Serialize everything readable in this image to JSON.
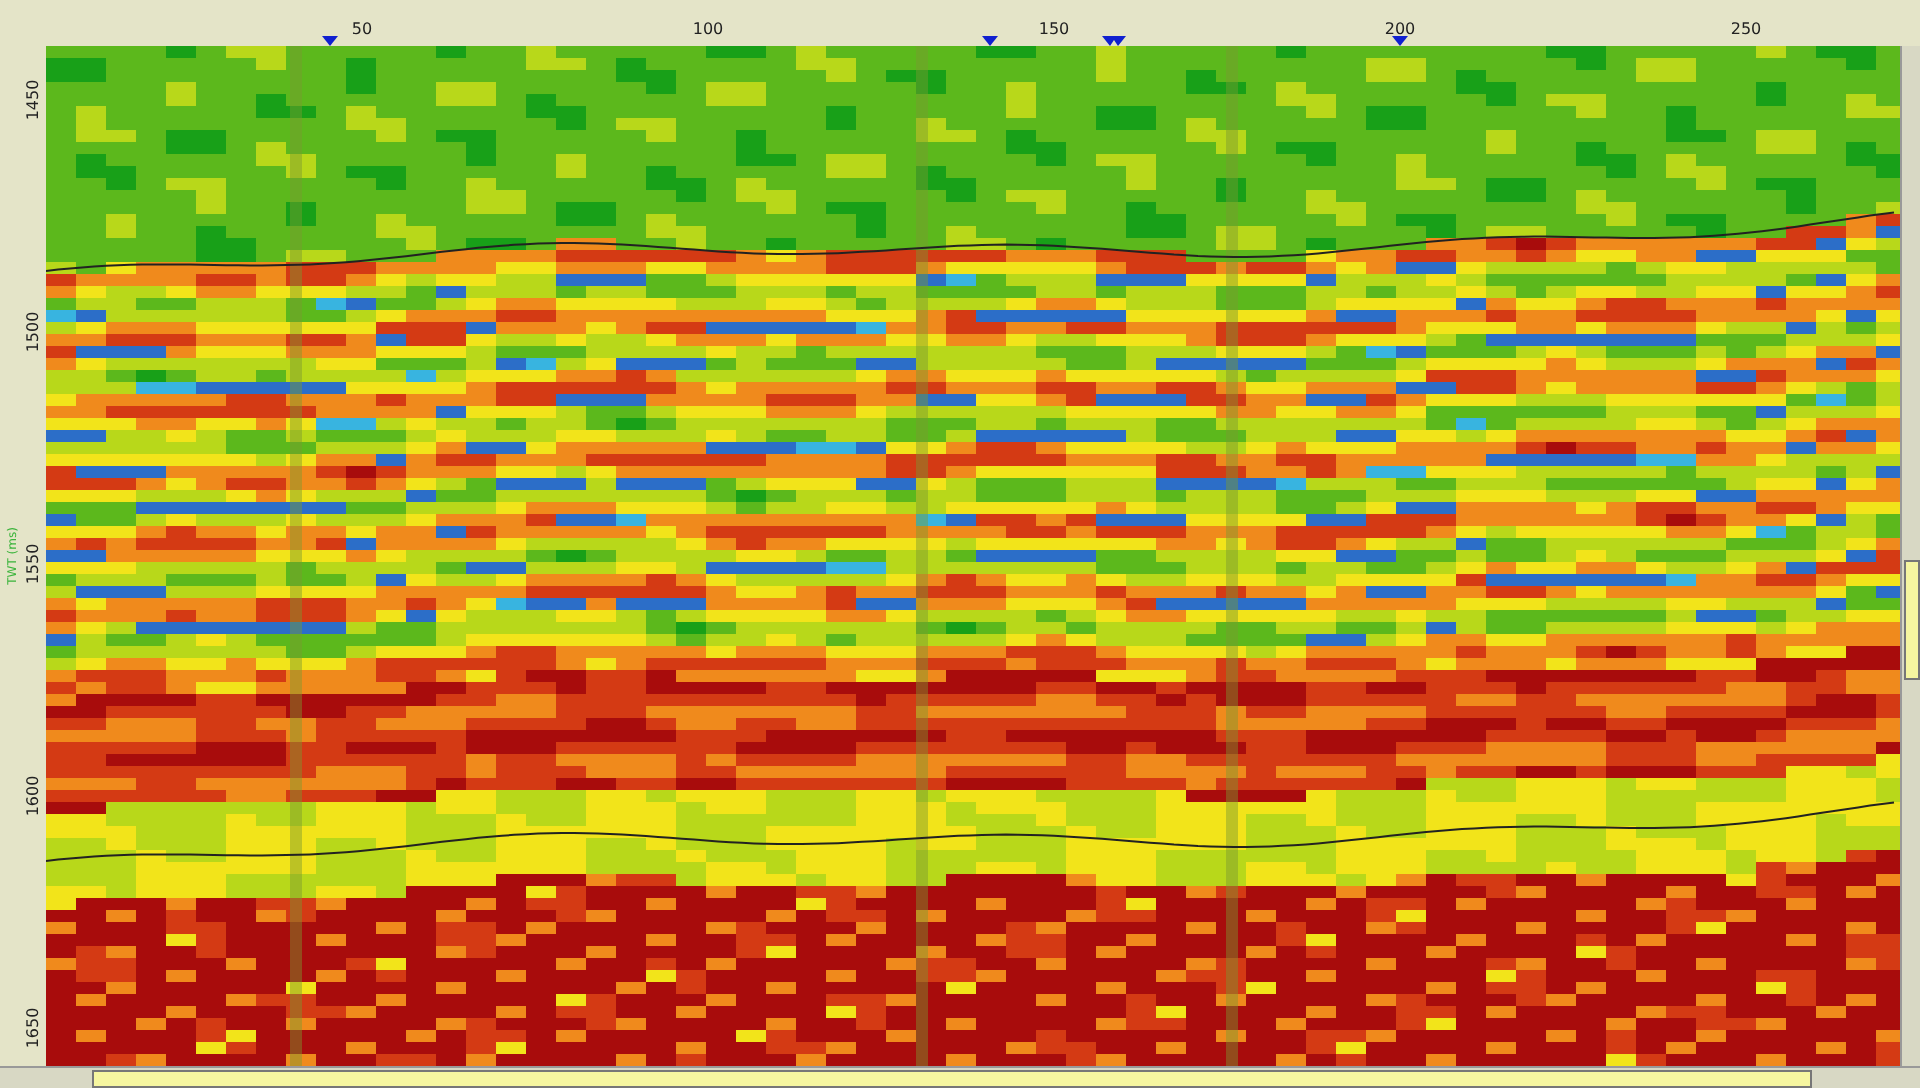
{
  "x_axis": {
    "ticks": [
      "50",
      "100",
      "150",
      "200",
      "250"
    ]
  },
  "y_axis": {
    "label": "TWT (ms)",
    "ticks": [
      "1450",
      "1500",
      "1550",
      "1600",
      "1650"
    ]
  }
}
